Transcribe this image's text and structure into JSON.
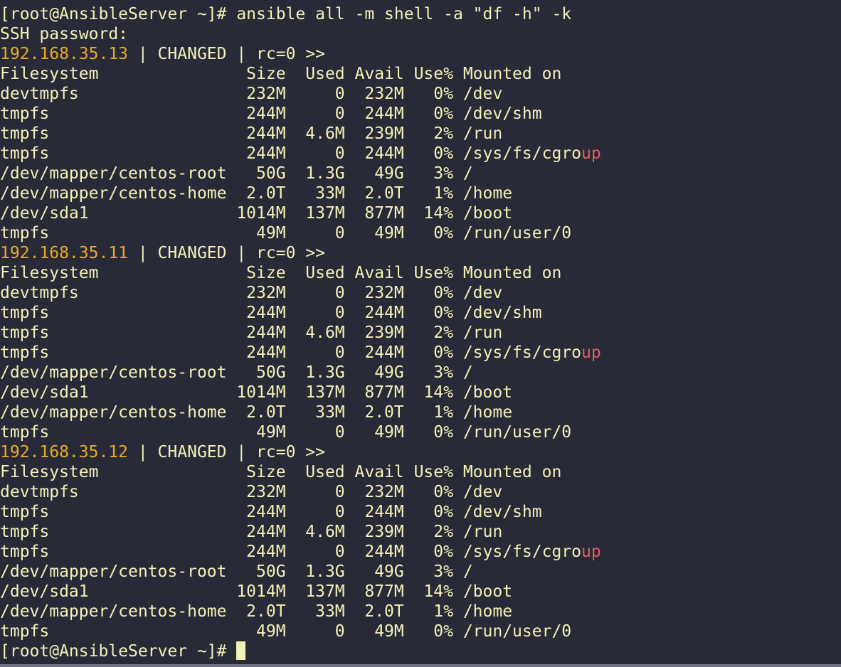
{
  "terminal": {
    "command_line": "[root@AnsibleServer ~]# ansible all -m shell -a \"df -h\" -k",
    "password_prompt": "SSH password:",
    "final_prompt": "[root@AnsibleServer ~]# ",
    "colors": {
      "background": "#282b37",
      "text": "#f3f0b8",
      "ip": "#e8a92a",
      "warning": "#e35d5d"
    },
    "hosts": [
      {
        "ip": "192.168.35.13",
        "status": " | CHANGED | rc=0 >>",
        "header": "Filesystem               Size  Used Avail Use% Mounted on",
        "rows": [
          {
            "text": "devtmpfs                 232M     0  232M   0% /dev"
          },
          {
            "text": "tmpfs                    244M     0  244M   0% /dev/shm"
          },
          {
            "text": "tmpfs                    244M  4.6M  239M   2% /run"
          },
          {
            "text": "tmpfs                    244M     0  244M   0% /sys/fs/cgro",
            "warn": "up"
          },
          {
            "text": "/dev/mapper/centos-root   50G  1.3G   49G   3% /"
          },
          {
            "text": "/dev/mapper/centos-home  2.0T   33M  2.0T   1% /home"
          },
          {
            "text": "/dev/sda1               1014M  137M  877M  14% /boot"
          },
          {
            "text": "tmpfs                     49M     0   49M   0% /run/user/0"
          }
        ]
      },
      {
        "ip": "192.168.35.11",
        "status": " | CHANGED | rc=0 >>",
        "header": "Filesystem               Size  Used Avail Use% Mounted on",
        "rows": [
          {
            "text": "devtmpfs                 232M     0  232M   0% /dev"
          },
          {
            "text": "tmpfs                    244M     0  244M   0% /dev/shm"
          },
          {
            "text": "tmpfs                    244M  4.6M  239M   2% /run"
          },
          {
            "text": "tmpfs                    244M     0  244M   0% /sys/fs/cgro",
            "warn": "up"
          },
          {
            "text": "/dev/mapper/centos-root   50G  1.3G   49G   3% /"
          },
          {
            "text": "/dev/sda1               1014M  137M  877M  14% /boot"
          },
          {
            "text": "/dev/mapper/centos-home  2.0T   33M  2.0T   1% /home"
          },
          {
            "text": "tmpfs                     49M     0   49M   0% /run/user/0"
          }
        ]
      },
      {
        "ip": "192.168.35.12",
        "status": " | CHANGED | rc=0 >>",
        "header": "Filesystem               Size  Used Avail Use% Mounted on",
        "rows": [
          {
            "text": "devtmpfs                 232M     0  232M   0% /dev"
          },
          {
            "text": "tmpfs                    244M     0  244M   0% /dev/shm"
          },
          {
            "text": "tmpfs                    244M  4.6M  239M   2% /run"
          },
          {
            "text": "tmpfs                    244M     0  244M   0% /sys/fs/cgro",
            "warn": "up"
          },
          {
            "text": "/dev/mapper/centos-root   50G  1.3G   49G   3% /"
          },
          {
            "text": "/dev/sda1               1014M  137M  877M  14% /boot"
          },
          {
            "text": "/dev/mapper/centos-home  2.0T   33M  2.0T   1% /home"
          },
          {
            "text": "tmpfs                     49M     0   49M   0% /run/user/0"
          }
        ]
      }
    ]
  }
}
